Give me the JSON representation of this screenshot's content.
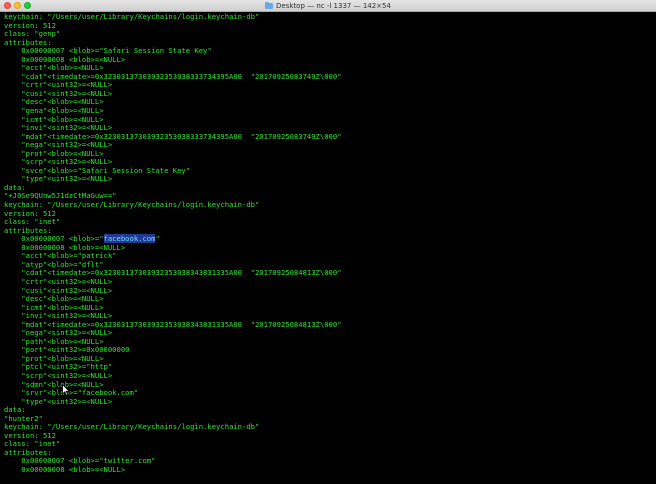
{
  "window": {
    "title": "Desktop — nc -l 1337 — 142×54"
  },
  "terminal": {
    "lines": [
      {
        "pre": "keychain: \"/Users/user/Library/Keychains/login.keychain-db\""
      },
      {
        "pre": "version: 512"
      },
      {
        "pre": "class: \"genp\""
      },
      {
        "pre": "attributes:"
      },
      {
        "pre": "    0x00000007 <blob>=\"Safari Session State Key\""
      },
      {
        "pre": "    0x00000008 <blob>=<NULL>"
      },
      {
        "pre": "    \"acct\"<blob>=<NULL>"
      },
      {
        "pre": "    \"cdat\"<timedate>=0x32303137303932353038333734395A00  \"20170925083749Z\\000\""
      },
      {
        "pre": "    \"crtr\"<uint32>=<NULL>"
      },
      {
        "pre": "    \"cusi\"<sint32>=<NULL>"
      },
      {
        "pre": "    \"desc\"<blob>=<NULL>"
      },
      {
        "pre": "    \"gena\"<blob>=<NULL>"
      },
      {
        "pre": "    \"icmt\"<blob>=<NULL>"
      },
      {
        "pre": "    \"invi\"<sint32>=<NULL>"
      },
      {
        "pre": "    \"mdat\"<timedate>=0x32303137303932353038333734395A00  \"20170925083749Z\\000\""
      },
      {
        "pre": "    \"nega\"<sint32>=<NULL>"
      },
      {
        "pre": "    \"prot\"<blob>=<NULL>"
      },
      {
        "pre": "    \"scrp\"<sint32>=<NULL>"
      },
      {
        "pre": "    \"svce\"<blob>=\"Safari Session State Key\""
      },
      {
        "pre": "    \"type\"<uint32>=<NULL>"
      },
      {
        "pre": "data:"
      },
      {
        "pre": "\"+J0Se9QUnw5J1dzCtMaGuw==\""
      },
      {
        "pre": "keychain: \"/Users/user/Library/Keychains/login.keychain-db\""
      },
      {
        "pre": "version: 512"
      },
      {
        "pre": "class: \"inet\""
      },
      {
        "pre": "attributes:"
      },
      {
        "pre": "    0x00000007 <blob>=\"",
        "hl": "facebook.com",
        "post": "\""
      },
      {
        "pre": "    0x00000008 <blob>=<NULL>"
      },
      {
        "pre": "    \"acct\"<blob>=\"patrick\""
      },
      {
        "pre": "    \"atyp\"<blob>=\"dflt\""
      },
      {
        "pre": "    \"cdat\"<timedate>=0x32303137303932353038343831335A00  \"20170925084813Z\\000\""
      },
      {
        "pre": "    \"crtr\"<uint32>=<NULL>"
      },
      {
        "pre": "    \"cusi\"<sint32>=<NULL>"
      },
      {
        "pre": "    \"desc\"<blob>=<NULL>"
      },
      {
        "pre": "    \"icmt\"<blob>=<NULL>"
      },
      {
        "pre": "    \"invi\"<sint32>=<NULL>"
      },
      {
        "pre": "    \"mdat\"<timedate>=0x32303137303932353038343831335A00  \"20170925084813Z\\000\""
      },
      {
        "pre": "    \"nega\"<sint32>=<NULL>"
      },
      {
        "pre": "    \"path\"<blob>=<NULL>"
      },
      {
        "pre": "    \"port\"<uint32>=0x00000000"
      },
      {
        "pre": "    \"prot\"<blob>=<NULL>"
      },
      {
        "pre": "    \"ptcl\"<uint32>=\"http\""
      },
      {
        "pre": "    \"scrp\"<sint32>=<NULL>"
      },
      {
        "pre": "    \"sdmn\"<blob>=<NULL>"
      },
      {
        "pre": "    \"srvr\"<blob>=\"facebook.com\""
      },
      {
        "pre": "    \"type\"<uint32>=<NULL>"
      },
      {
        "pre": "data:"
      },
      {
        "pre": "\"hunter2\""
      },
      {
        "pre": "keychain: \"/Users/user/Library/Keychains/login.keychain-db\""
      },
      {
        "pre": "version: 512"
      },
      {
        "pre": "class: \"inet\""
      },
      {
        "pre": "attributes:"
      },
      {
        "pre": "    0x00000007 <blob>=\"twitter.com\""
      },
      {
        "pre": "    0x00000008 <blob>=<NULL>"
      }
    ]
  },
  "colors": {
    "background": "#000000",
    "text": "#2ee62e",
    "selection_bg": "#1e3a94",
    "selection_text": "#6fd9ff"
  },
  "icons": {
    "close": "close-button",
    "minimize": "minimize-button",
    "maximize": "maximize-button",
    "title": "folder-icon",
    "cursor": "mouse-pointer-icon"
  }
}
